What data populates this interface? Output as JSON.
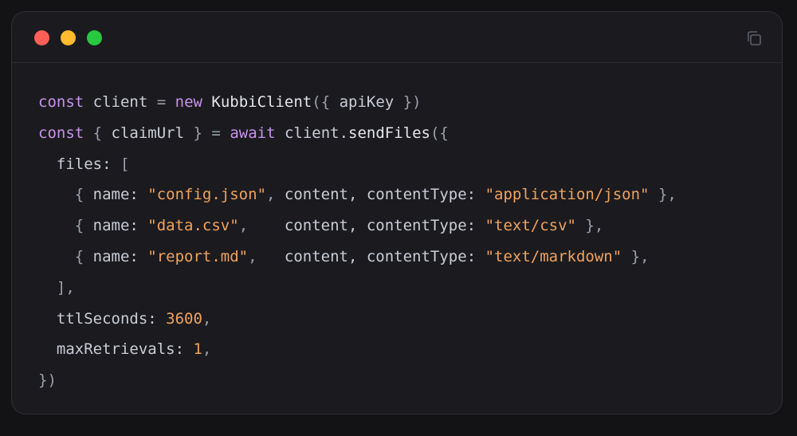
{
  "window": {
    "traffic_lights": [
      {
        "name": "close",
        "color": "#ff5f57"
      },
      {
        "name": "minimize",
        "color": "#febc2e"
      },
      {
        "name": "maximize",
        "color": "#28c840"
      }
    ],
    "copy_icon": "copy-icon"
  },
  "colors": {
    "background": "#131316",
    "window": "#1b1b1f",
    "keyword": "#c792ea",
    "string": "#f0a35e",
    "number": "#f0a35e",
    "text": "#c9cdd6"
  },
  "code": {
    "language": "javascript",
    "lines": [
      [
        [
          "kw",
          "const"
        ],
        [
          "plain",
          " client "
        ],
        [
          "punc",
          "="
        ],
        [
          "plain",
          " "
        ],
        [
          "kw",
          "new"
        ],
        [
          "plain",
          " "
        ],
        [
          "fn",
          "KubbiClient"
        ],
        [
          "punc",
          "({"
        ],
        [
          "plain",
          " apiKey "
        ],
        [
          "punc",
          "})"
        ]
      ],
      [
        [
          "kw",
          "const"
        ],
        [
          "plain",
          " "
        ],
        [
          "punc",
          "{"
        ],
        [
          "plain",
          " claimUrl "
        ],
        [
          "punc",
          "}"
        ],
        [
          "plain",
          " "
        ],
        [
          "punc",
          "="
        ],
        [
          "plain",
          " "
        ],
        [
          "kw",
          "await"
        ],
        [
          "plain",
          " client."
        ],
        [
          "fn",
          "sendFiles"
        ],
        [
          "punc",
          "({"
        ]
      ],
      [
        [
          "plain",
          "  files: "
        ],
        [
          "punc",
          "["
        ]
      ],
      [
        [
          "plain",
          "    "
        ],
        [
          "punc",
          "{"
        ],
        [
          "plain",
          " name: "
        ],
        [
          "str",
          "\"config.json\""
        ],
        [
          "punc",
          ","
        ],
        [
          "plain",
          " content, contentType: "
        ],
        [
          "str",
          "\"application/json\""
        ],
        [
          "plain",
          " "
        ],
        [
          "punc",
          "},"
        ]
      ],
      [
        [
          "plain",
          "    "
        ],
        [
          "punc",
          "{"
        ],
        [
          "plain",
          " name: "
        ],
        [
          "str",
          "\"data.csv\""
        ],
        [
          "punc",
          ","
        ],
        [
          "plain",
          "    content, contentType: "
        ],
        [
          "str",
          "\"text/csv\""
        ],
        [
          "plain",
          " "
        ],
        [
          "punc",
          "},"
        ]
      ],
      [
        [
          "plain",
          "    "
        ],
        [
          "punc",
          "{"
        ],
        [
          "plain",
          " name: "
        ],
        [
          "str",
          "\"report.md\""
        ],
        [
          "punc",
          ","
        ],
        [
          "plain",
          "   content, contentType: "
        ],
        [
          "str",
          "\"text/markdown\""
        ],
        [
          "plain",
          " "
        ],
        [
          "punc",
          "},"
        ]
      ],
      [
        [
          "plain",
          "  "
        ],
        [
          "punc",
          "],"
        ]
      ],
      [
        [
          "plain",
          "  ttlSeconds: "
        ],
        [
          "num",
          "3600"
        ],
        [
          "punc",
          ","
        ]
      ],
      [
        [
          "plain",
          "  maxRetrievals: "
        ],
        [
          "num",
          "1"
        ],
        [
          "punc",
          ","
        ]
      ],
      [
        [
          "punc",
          "})"
        ]
      ]
    ]
  }
}
